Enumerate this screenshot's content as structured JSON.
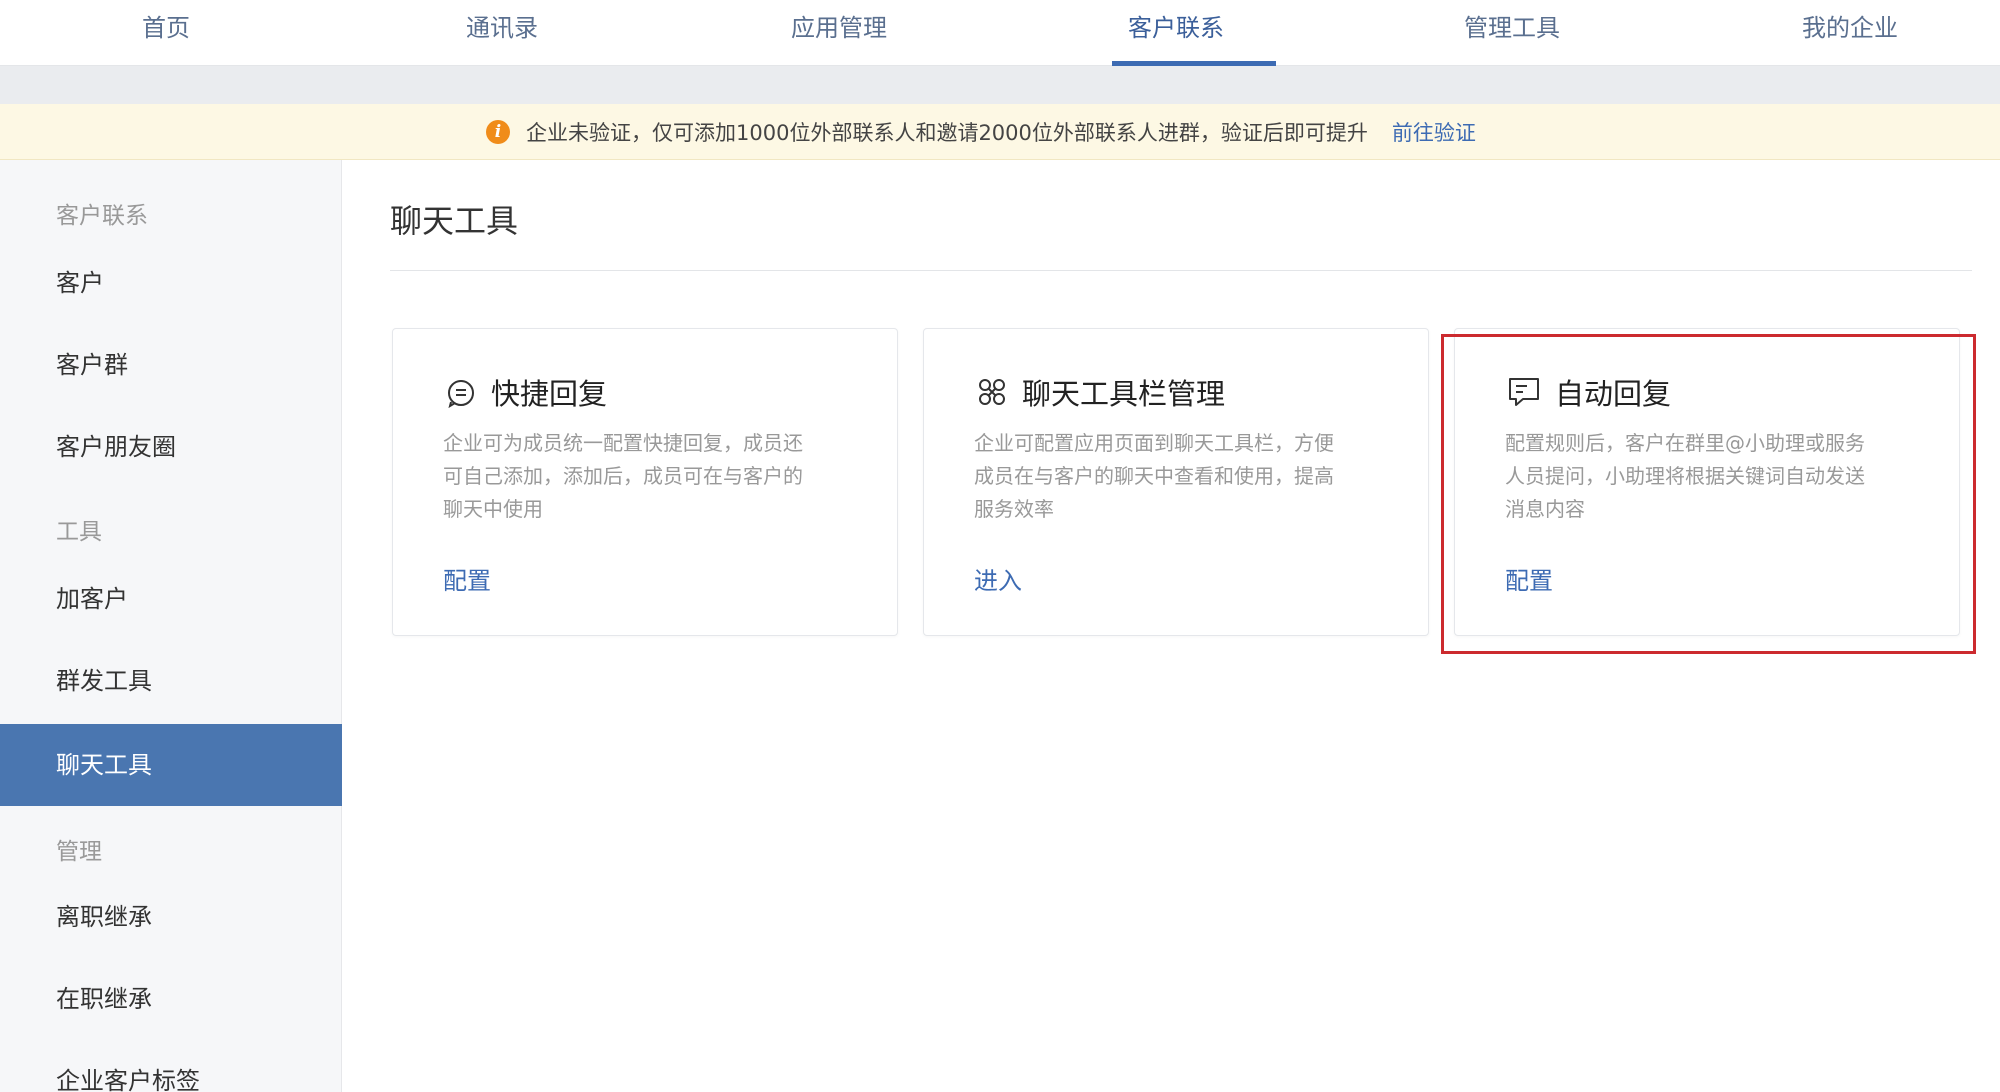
{
  "topnav": {
    "tabs": [
      {
        "label": "首页"
      },
      {
        "label": "通讯录"
      },
      {
        "label": "应用管理"
      },
      {
        "label": "客户联系"
      },
      {
        "label": "管理工具"
      },
      {
        "label": "我的企业"
      }
    ],
    "active_tab": "客户联系"
  },
  "notice": {
    "icon": "warning-icon",
    "message": "企业未验证，仅可添加1000位外部联系人和邀请2000位外部联系人进群，验证后即可提升",
    "link": "前往验证"
  },
  "sidebar": {
    "groups": [
      "客户联系",
      "工具",
      "管理"
    ],
    "items": [
      {
        "label": "客户"
      },
      {
        "label": "客户群"
      },
      {
        "label": "客户朋友圈"
      },
      {
        "label": "加客户"
      },
      {
        "label": "群发工具"
      },
      {
        "label": "聊天工具"
      },
      {
        "label": "离职继承"
      },
      {
        "label": "在职继承"
      },
      {
        "label": "企业客户标签"
      }
    ],
    "active_item": "聊天工具"
  },
  "main": {
    "title": "聊天工具",
    "cards": [
      {
        "icon": "quick-reply-icon",
        "title": "快捷回复",
        "desc": [
          "企业可为成员统一配置快捷回复，成员还",
          "可自己添加，添加后，成员可在与客户的",
          "聊天中使用"
        ],
        "action": "配置"
      },
      {
        "icon": "toolbar-icon",
        "title": "聊天工具栏管理",
        "desc": [
          "企业可配置应用页面到聊天工具栏，方便",
          "成员在与客户的聊天中查看和使用，提高",
          "服务效率"
        ],
        "action": "进入"
      },
      {
        "icon": "auto-reply-icon",
        "title": "自动回复",
        "desc": [
          "配置规则后，客户在群里@小助理或服务",
          "人员提问，小助理将根据关键词自动发送",
          "消息内容"
        ],
        "action": "配置"
      }
    ]
  },
  "colors": {
    "accent": "#3d6bb3",
    "sidebar_active": "#4a76b0",
    "highlight": "#cc2a2f",
    "notice_bg": "#fdf8e4"
  }
}
